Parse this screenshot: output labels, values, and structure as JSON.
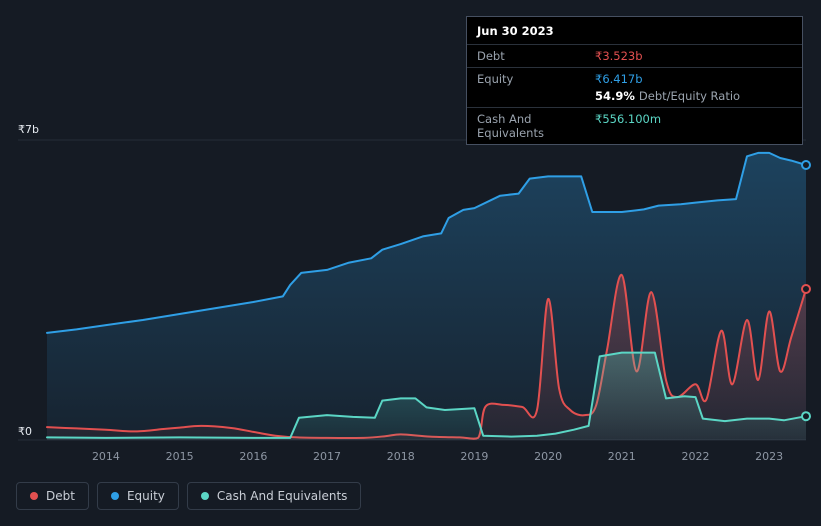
{
  "tooltip": {
    "date": "Jun 30 2023",
    "debt_label": "Debt",
    "debt_value": "₹3.523b",
    "equity_label": "Equity",
    "equity_value": "₹6.417b",
    "ratio_value": "54.9%",
    "ratio_label": "Debt/Equity Ratio",
    "cash_label": "Cash And Equivalents",
    "cash_value": "₹556.100m"
  },
  "legend": [
    {
      "label": "Debt",
      "color": "#e25050"
    },
    {
      "label": "Equity",
      "color": "#2f9fe6"
    },
    {
      "label": "Cash And Equivalents",
      "color": "#5bd6c5"
    }
  ],
  "chart_data": {
    "type": "area",
    "x_ticks": [
      2014,
      2015,
      2016,
      2017,
      2018,
      2019,
      2020,
      2021,
      2022,
      2023
    ],
    "y_axis": {
      "max_label": "₹7b",
      "zero_label": "₹0",
      "ylim": [
        0,
        7
      ],
      "unit": "₹ billions"
    },
    "last_point_date": "Jun 30 2023",
    "series": [
      {
        "name": "Equity",
        "color": "#2f9fe6",
        "smooth": false,
        "points": [
          [
            2013.2,
            2.5
          ],
          [
            2013.6,
            2.58
          ],
          [
            2014.0,
            2.68
          ],
          [
            2014.5,
            2.8
          ],
          [
            2015.0,
            2.94
          ],
          [
            2015.5,
            3.08
          ],
          [
            2016.0,
            3.22
          ],
          [
            2016.4,
            3.35
          ],
          [
            2016.5,
            3.62
          ],
          [
            2016.65,
            3.9
          ],
          [
            2017.0,
            3.97
          ],
          [
            2017.3,
            4.14
          ],
          [
            2017.6,
            4.24
          ],
          [
            2017.75,
            4.44
          ],
          [
            2018.0,
            4.57
          ],
          [
            2018.3,
            4.75
          ],
          [
            2018.55,
            4.82
          ],
          [
            2018.65,
            5.18
          ],
          [
            2018.85,
            5.37
          ],
          [
            2019.0,
            5.41
          ],
          [
            2019.35,
            5.7
          ],
          [
            2019.6,
            5.75
          ],
          [
            2019.75,
            6.1
          ],
          [
            2020.0,
            6.15
          ],
          [
            2020.45,
            6.15
          ],
          [
            2020.6,
            5.32
          ],
          [
            2021.0,
            5.32
          ],
          [
            2021.3,
            5.38
          ],
          [
            2021.5,
            5.47
          ],
          [
            2021.8,
            5.5
          ],
          [
            2022.0,
            5.54
          ],
          [
            2022.3,
            5.59
          ],
          [
            2022.55,
            5.62
          ],
          [
            2022.7,
            6.62
          ],
          [
            2022.85,
            6.7
          ],
          [
            2023.0,
            6.7
          ],
          [
            2023.15,
            6.58
          ],
          [
            2023.3,
            6.52
          ],
          [
            2023.5,
            6.417
          ]
        ]
      },
      {
        "name": "Debt",
        "color": "#e25050",
        "smooth": true,
        "points": [
          [
            2013.2,
            0.3
          ],
          [
            2013.6,
            0.27
          ],
          [
            2014.0,
            0.24
          ],
          [
            2014.4,
            0.2
          ],
          [
            2014.8,
            0.26
          ],
          [
            2015.0,
            0.29
          ],
          [
            2015.3,
            0.33
          ],
          [
            2015.7,
            0.28
          ],
          [
            2016.0,
            0.19
          ],
          [
            2016.3,
            0.1
          ],
          [
            2016.6,
            0.06
          ],
          [
            2017.0,
            0.05
          ],
          [
            2017.5,
            0.05
          ],
          [
            2017.8,
            0.09
          ],
          [
            2018.0,
            0.13
          ],
          [
            2018.4,
            0.08
          ],
          [
            2018.8,
            0.06
          ],
          [
            2019.05,
            0.05
          ],
          [
            2019.15,
            0.78
          ],
          [
            2019.4,
            0.82
          ],
          [
            2019.65,
            0.77
          ],
          [
            2019.85,
            0.7
          ],
          [
            2020.0,
            3.29
          ],
          [
            2020.15,
            1.2
          ],
          [
            2020.3,
            0.7
          ],
          [
            2020.5,
            0.58
          ],
          [
            2020.65,
            0.8
          ],
          [
            2020.8,
            2.1
          ],
          [
            2021.0,
            3.85
          ],
          [
            2021.2,
            1.6
          ],
          [
            2021.4,
            3.45
          ],
          [
            2021.6,
            1.4
          ],
          [
            2021.75,
            1.0
          ],
          [
            2022.0,
            1.3
          ],
          [
            2022.15,
            0.95
          ],
          [
            2022.35,
            2.55
          ],
          [
            2022.5,
            1.3
          ],
          [
            2022.7,
            2.8
          ],
          [
            2022.85,
            1.4
          ],
          [
            2023.0,
            3.0
          ],
          [
            2023.15,
            1.6
          ],
          [
            2023.3,
            2.4
          ],
          [
            2023.5,
            3.523
          ]
        ]
      },
      {
        "name": "Cash And Equivalents",
        "color": "#5bd6c5",
        "smooth": false,
        "points": [
          [
            2013.2,
            0.06
          ],
          [
            2014.0,
            0.05
          ],
          [
            2015.0,
            0.06
          ],
          [
            2016.0,
            0.05
          ],
          [
            2016.5,
            0.05
          ],
          [
            2016.62,
            0.52
          ],
          [
            2017.0,
            0.58
          ],
          [
            2017.35,
            0.54
          ],
          [
            2017.65,
            0.52
          ],
          [
            2017.75,
            0.92
          ],
          [
            2018.0,
            0.97
          ],
          [
            2018.2,
            0.97
          ],
          [
            2018.35,
            0.76
          ],
          [
            2018.6,
            0.7
          ],
          [
            2019.0,
            0.74
          ],
          [
            2019.12,
            0.1
          ],
          [
            2019.5,
            0.08
          ],
          [
            2019.85,
            0.1
          ],
          [
            2020.1,
            0.15
          ],
          [
            2020.35,
            0.24
          ],
          [
            2020.55,
            0.33
          ],
          [
            2020.7,
            1.95
          ],
          [
            2021.0,
            2.04
          ],
          [
            2021.45,
            2.04
          ],
          [
            2021.6,
            0.97
          ],
          [
            2021.85,
            1.02
          ],
          [
            2022.0,
            1.0
          ],
          [
            2022.1,
            0.5
          ],
          [
            2022.4,
            0.44
          ],
          [
            2022.7,
            0.5
          ],
          [
            2023.0,
            0.5
          ],
          [
            2023.2,
            0.46
          ],
          [
            2023.5,
            0.556
          ]
        ]
      }
    ]
  }
}
